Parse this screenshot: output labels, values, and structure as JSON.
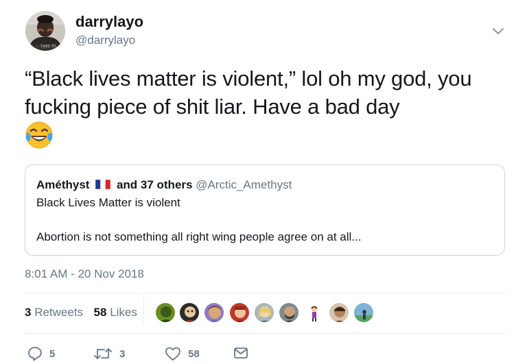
{
  "author": {
    "name": "darrylayo",
    "handle": "@darrylayo",
    "avatar_icon": "profile-photo-icon"
  },
  "tweet": {
    "text": "“Black lives matter is violent,” lol oh my god, you fucking piece of shit liar. Have a bad day",
    "emoji": "face-with-tears-of-joy-icon"
  },
  "quoted_tweet": {
    "name": "Améthyst",
    "flag": "france-flag-icon",
    "others": "and 37 others",
    "handle": "@Arctic_Amethyst",
    "line1": "Black Lives Matter is violent",
    "line2": "Abortion is not something all right wing people agree on at all..."
  },
  "timestamp": "8:01 AM - 20 Nov 2018",
  "stats": {
    "retweets_count": "3",
    "retweets_label": "Retweets",
    "likes_count": "58",
    "likes_label": "Likes"
  },
  "actions": {
    "reply_count": "5",
    "retweet_count": "3",
    "like_count": "58"
  },
  "colors": {
    "text": "#14171a",
    "secondary": "#657786",
    "border": "#ccd6dd",
    "divider": "#e6ecf0"
  }
}
